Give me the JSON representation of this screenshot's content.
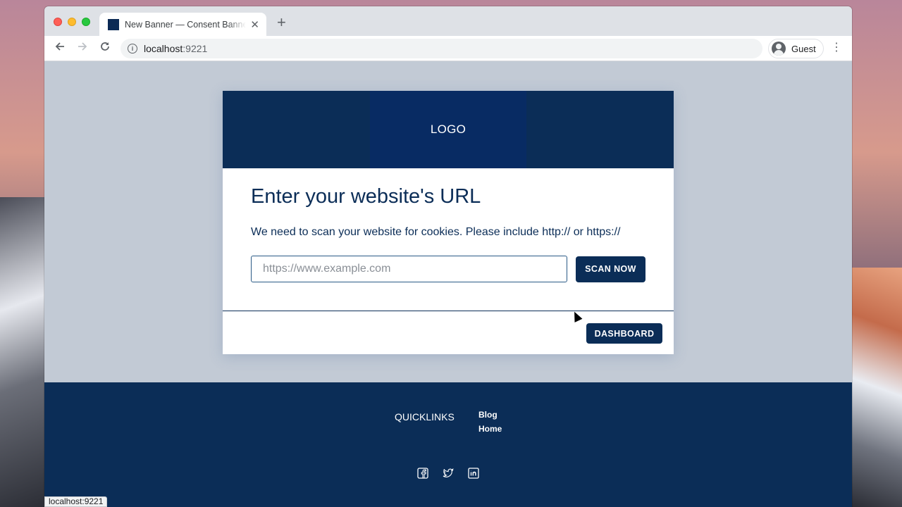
{
  "browser": {
    "tab_title": "New Banner — Consent Banner",
    "url_host": "localhost",
    "url_port": ":9221",
    "profile_label": "Guest",
    "status_text": "localhost:9221",
    "icons": {
      "close": "close-icon",
      "new_tab": "plus-icon",
      "back": "arrow-left-icon",
      "forward": "arrow-right-icon",
      "reload": "reload-icon",
      "info": "info-icon",
      "menu": "kebab-menu-icon"
    }
  },
  "card": {
    "logo": "LOGO",
    "title": "Enter your website's URL",
    "description": "We need to scan your website for cookies. Please include http:// or https://",
    "url_placeholder": "https://www.example.com",
    "url_value": "",
    "scan_label": "SCAN NOW",
    "dashboard_label": "DASHBOARD"
  },
  "footer": {
    "quicklinks_title": "QUICKLINKS",
    "links": [
      "Blog",
      "Home"
    ],
    "socials": [
      "facebook-icon",
      "twitter-icon",
      "linkedin-icon"
    ]
  },
  "colors": {
    "brand_navy": "#0b2d57",
    "page_bg": "#c2cad5"
  }
}
